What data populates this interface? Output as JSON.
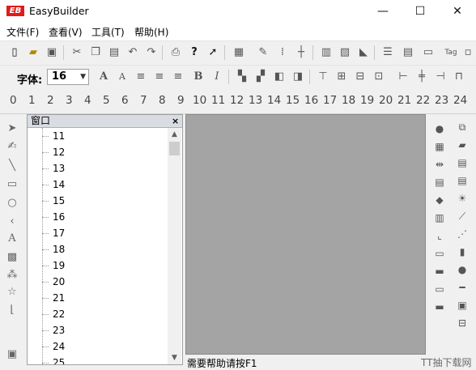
{
  "window": {
    "logo_text": "EB",
    "title": "EasyBuilder",
    "minimize_glyph": "—",
    "maximize_glyph": "☐",
    "close_glyph": "✕"
  },
  "menu": [
    {
      "label": "文件(F)"
    },
    {
      "label": "查看(V)"
    },
    {
      "label": "工具(T)"
    },
    {
      "label": "帮助(H)"
    }
  ],
  "toolbar1": {
    "icons": [
      "new-file-icon",
      "open-folder-icon",
      "save-icon",
      "cut-icon",
      "copy-icon",
      "paste-icon",
      "undo-icon",
      "redo-icon",
      "print-icon",
      "help-icon",
      "context-help-icon",
      "grid-icon",
      "pen-icon",
      "dotted-grid-icon",
      "snap-icon",
      "align-icon",
      "measure-icon",
      "ruler-icon",
      "list-icon",
      "table-icon",
      "tag-icon",
      "tag-label-icon",
      "more-icon"
    ],
    "tag_label": "Tag"
  },
  "toolbar2": {
    "font_label": "字体:",
    "font_size_value": "16",
    "icons": [
      "font-grow-icon",
      "font-shrink-icon",
      "align-left-icon",
      "align-center-icon",
      "align-right-icon",
      "bold-icon",
      "italic-icon",
      "group-icon",
      "ungroup-icon",
      "bring-front-icon",
      "send-back-icon",
      "align-top-icon",
      "align-middle-icon",
      "align-bottom-icon",
      "center-icon",
      "left-align-obj-icon",
      "vcenter-icon",
      "right-align-obj-icon",
      "hspace-icon",
      "vspace-icon"
    ],
    "bold_glyph": "B",
    "italic_glyph": "I"
  },
  "ruler": {
    "labels": [
      "0",
      "1",
      "2",
      "3",
      "4",
      "5",
      "6",
      "7",
      "8",
      "9",
      "10",
      "11",
      "12",
      "13",
      "14",
      "15",
      "16",
      "17",
      "18",
      "19",
      "20",
      "21",
      "22",
      "23",
      "24"
    ]
  },
  "left_tools": [
    "select-icon",
    "zoom-icon",
    "line-icon",
    "rectangle-icon",
    "circle-icon",
    "arc-icon",
    "text-icon",
    "bitmap-icon",
    "scale-icon",
    "star-icon",
    "bracket-icon",
    "extra-icon"
  ],
  "tree_panel": {
    "title": "窗口",
    "close_glyph": "×",
    "items": [
      "11",
      "12",
      "13",
      "14",
      "15",
      "16",
      "17",
      "18",
      "19",
      "20",
      "21",
      "22",
      "23",
      "24",
      "25"
    ]
  },
  "right_tools": {
    "col1": [
      "lamp-icon",
      "bit-lamp-icon",
      "word-lamp-icon",
      "numeric-icon",
      "set-bit-icon",
      "toggle-icon",
      "keypad-icon",
      "value-icon",
      "indicator-icon",
      "meter-icon",
      "bar-icon",
      "display-icon",
      "shape-icon"
    ],
    "col2": [
      "window-icon",
      "layers-icon",
      "numeric-display-icon",
      "counter-icon",
      "alarm-icon",
      "trend-icon",
      "xy-plot-icon",
      "bar-chart-icon",
      "pie-icon",
      "scroll-bar-icon",
      "picture-icon",
      "recipe-icon",
      "report-icon"
    ]
  },
  "status": {
    "text": "需要帮助请按F1"
  },
  "watermark": "TT抽下载网"
}
